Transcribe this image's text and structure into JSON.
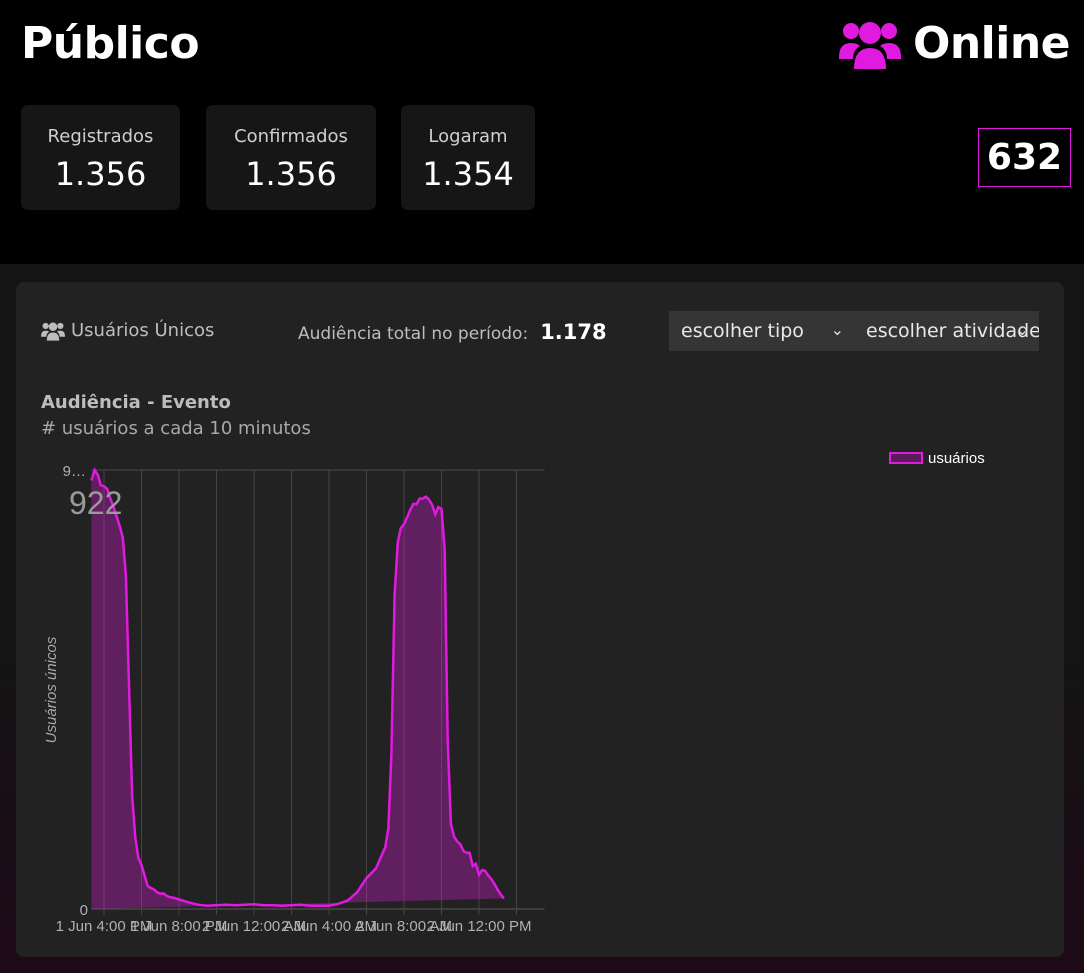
{
  "header": {
    "title": "Público",
    "online_label": "Online",
    "online_icon": "users-icon",
    "online_count": "632",
    "accent_color": "#e01adf"
  },
  "stats": [
    {
      "label": "Registrados",
      "value": "1.356"
    },
    {
      "label": "Confirmados",
      "value": "1.356"
    },
    {
      "label": "Logaram",
      "value": "1.354"
    }
  ],
  "panel": {
    "unique_label": "Usuários Únicos",
    "unique_icon": "users-icon",
    "audience_label": "Audiência total no período:",
    "audience_value": "1.178",
    "select_type": "escolher tipo",
    "select_activity": "escolher atividade",
    "chart_title": "Audiência - Evento",
    "chart_subtitle": "# usuários a cada 10 minutos"
  },
  "chart_data": {
    "type": "area",
    "ylabel": "Usuários únicos",
    "y_top_tick": "9…",
    "peak_label": "922",
    "ylim": [
      0,
      922
    ],
    "x_tick_labels": [
      "1 Jun 4:00 PM",
      "1 Jun 8:00 PM",
      "2 Jun 12:00 AM",
      "2 Jun 4:00 AM",
      "2 Jun 8:00 AM",
      "2 Jun 12:00 PM"
    ],
    "x_ticks_hours": [
      0,
      4,
      8,
      12,
      16,
      20
    ],
    "x_start_hour": -0.67,
    "x_end_hour": 23.5,
    "series": [
      {
        "name": "usuários",
        "color": "#e01adf",
        "x_hours": [
          -0.67,
          -0.5,
          -0.33,
          -0.17,
          0,
          0.17,
          0.33,
          0.5,
          0.67,
          0.83,
          1,
          1.17,
          1.33,
          1.5,
          1.67,
          1.83,
          2,
          2.17,
          2.33,
          2.5,
          2.67,
          2.83,
          3,
          3.17,
          3.33,
          3.5,
          3.67,
          3.83,
          4,
          4.5,
          5,
          5.5,
          6,
          6.5,
          7,
          7.5,
          8,
          8.5,
          9,
          9.5,
          10,
          10.5,
          11,
          11.5,
          12,
          12.5,
          13,
          13.5,
          14,
          14.5,
          15,
          15.17,
          15.33,
          15.5,
          15.67,
          15.83,
          16,
          16.17,
          16.33,
          16.5,
          16.67,
          16.83,
          17,
          17.17,
          17.33,
          17.5,
          17.67,
          17.83,
          18,
          18.17,
          18.33,
          18.5,
          18.67,
          18.83,
          19,
          19.17,
          19.33,
          19.5,
          19.67,
          19.83,
          20,
          20.17,
          20.33,
          20.5,
          20.67,
          20.83,
          21,
          21.17,
          21.33,
          21.5,
          21.67,
          21.83,
          22,
          22.17,
          22.33,
          22.5,
          22.67,
          22.83,
          23,
          23.17,
          23.33,
          23.5
        ],
        "values": [
          900,
          922,
          912,
          890,
          888,
          882,
          863,
          845,
          825,
          805,
          780,
          700,
          478,
          240,
          150,
          108,
          92,
          70,
          48,
          44,
          41,
          35,
          32,
          33,
          28,
          25,
          24,
          22,
          20,
          14,
          9,
          7,
          8,
          9,
          8,
          9,
          10,
          8,
          8,
          7,
          8,
          9,
          7,
          7,
          7,
          11,
          18,
          35,
          65,
          85,
          130,
          170,
          325,
          660,
          770,
          800,
          808,
          823,
          838,
          851,
          850,
          862,
          862,
          866,
          860,
          849,
          829,
          844,
          840,
          754,
          355,
          178,
          152,
          142,
          136,
          122,
          118,
          118,
          90,
          95,
          72,
          82,
          80,
          70,
          62,
          52,
          40,
          30,
          22
        ],
        "values_note": ""
      }
    ],
    "legend": "top-right",
    "grid": true
  }
}
